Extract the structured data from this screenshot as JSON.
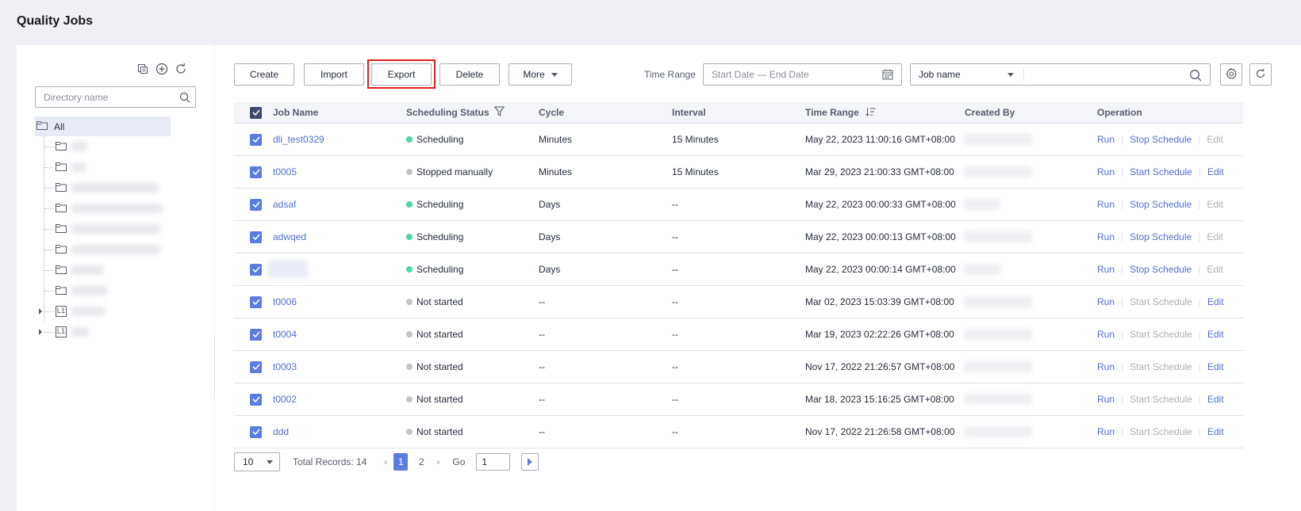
{
  "page": {
    "title": "Quality Jobs"
  },
  "directory": {
    "search_placeholder": "Directory name",
    "root_label": "All",
    "tools": [
      "copy-icon",
      "add-circle-icon",
      "refresh-icon"
    ]
  },
  "toolbar": {
    "create": "Create",
    "import": "Import",
    "export": "Export",
    "delete": "Delete",
    "more": "More",
    "time_range_label": "Time Range",
    "date_placeholder": "Start Date — End Date",
    "filter_select": "Job name"
  },
  "table": {
    "headers": {
      "name": "Job Name",
      "status": "Scheduling Status",
      "cycle": "Cycle",
      "interval": "Interval",
      "time_range": "Time Range",
      "created_by": "Created By",
      "operation": "Operation"
    },
    "rows": [
      {
        "name": "dli_test0329",
        "status": "Scheduling",
        "status_color": "green",
        "cycle": "Minutes",
        "interval": "15 Minutes",
        "time": "May 22, 2023 11:00:16 GMT+08:00",
        "run": "Run",
        "schedule": "Stop Schedule",
        "schedule_enabled": true,
        "edit": "Edit",
        "edit_enabled": false
      },
      {
        "name": "t0005",
        "status": "Stopped manually",
        "status_color": "gray",
        "cycle": "Minutes",
        "interval": "15 Minutes",
        "time": "Mar 29, 2023 21:00:33 GMT+08:00",
        "run": "Run",
        "schedule": "Start Schedule",
        "schedule_enabled": true,
        "edit": "Edit",
        "edit_enabled": true
      },
      {
        "name": "adsaf",
        "status": "Scheduling",
        "status_color": "green",
        "cycle": "Days",
        "interval": "--",
        "time": "May 22, 2023 00:00:33 GMT+08:00",
        "run": "Run",
        "schedule": "Stop Schedule",
        "schedule_enabled": true,
        "edit": "Edit",
        "edit_enabled": false
      },
      {
        "name": "adwqed",
        "status": "Scheduling",
        "status_color": "green",
        "cycle": "Days",
        "interval": "--",
        "time": "May 22, 2023 00:00:13 GMT+08:00",
        "run": "Run",
        "schedule": "Stop Schedule",
        "schedule_enabled": true,
        "edit": "Edit",
        "edit_enabled": false
      },
      {
        "name": "",
        "status": "Scheduling",
        "status_color": "green",
        "cycle": "Days",
        "interval": "--",
        "time": "May 22, 2023 00:00:14 GMT+08:00",
        "run": "Run",
        "schedule": "Stop Schedule",
        "schedule_enabled": true,
        "edit": "Edit",
        "edit_enabled": false
      },
      {
        "name": "t0006",
        "status": "Not started",
        "status_color": "gray",
        "cycle": "--",
        "interval": "--",
        "time": "Mar 02, 2023 15:03:39 GMT+08:00",
        "run": "Run",
        "schedule": "Start Schedule",
        "schedule_enabled": false,
        "edit": "Edit",
        "edit_enabled": true
      },
      {
        "name": "t0004",
        "status": "Not started",
        "status_color": "gray",
        "cycle": "--",
        "interval": "--",
        "time": "Mar 19, 2023 02:22:26 GMT+08:00",
        "run": "Run",
        "schedule": "Start Schedule",
        "schedule_enabled": false,
        "edit": "Edit",
        "edit_enabled": true
      },
      {
        "name": "t0003",
        "status": "Not started",
        "status_color": "gray",
        "cycle": "--",
        "interval": "--",
        "time": "Nov 17, 2022 21:26:57 GMT+08:00",
        "run": "Run",
        "schedule": "Start Schedule",
        "schedule_enabled": false,
        "edit": "Edit",
        "edit_enabled": true
      },
      {
        "name": "t0002",
        "status": "Not started",
        "status_color": "gray",
        "cycle": "--",
        "interval": "--",
        "time": "Mar 18, 2023 15:16:25 GMT+08:00",
        "run": "Run",
        "schedule": "Start Schedule",
        "schedule_enabled": false,
        "edit": "Edit",
        "edit_enabled": true
      },
      {
        "name": "ddd",
        "status": "Not started",
        "status_color": "gray",
        "cycle": "--",
        "interval": "--",
        "time": "Nov 17, 2022 21:26:58 GMT+08:00",
        "run": "Run",
        "schedule": "Start Schedule",
        "schedule_enabled": false,
        "edit": "Edit",
        "edit_enabled": true
      }
    ]
  },
  "pagination": {
    "page_size": "10",
    "total": "Total Records: 14",
    "pages": [
      "1",
      "2"
    ],
    "current": "1",
    "go_label": "Go",
    "go_value": "1"
  },
  "colors": {
    "accent": "#5e7ce0",
    "link": "#526ecc",
    "highlight": "#e02020",
    "status_green": "#50d4ab",
    "status_gray": "#c2c5cc"
  }
}
